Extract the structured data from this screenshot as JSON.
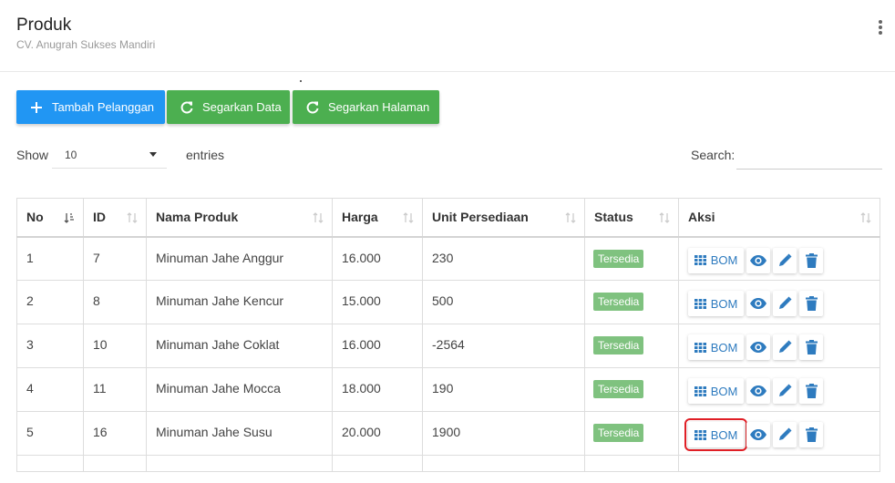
{
  "header": {
    "title": "Produk",
    "subtitle": "CV. Anugrah Sukses Mandiri"
  },
  "toolbar": {
    "add_label": "Tambah Pelanggan",
    "refresh_data_label": "Segarkan Data",
    "refresh_page_label": "Segarkan Halaman"
  },
  "length": {
    "show_label": "Show",
    "value": "10",
    "entries_label": "entries"
  },
  "search": {
    "label": "Search:",
    "value": ""
  },
  "table": {
    "columns": [
      "No",
      "ID",
      "Nama Produk",
      "Harga",
      "Unit Persediaan",
      "Status",
      "Aksi"
    ],
    "rows": [
      {
        "no": "1",
        "id": "7",
        "name": "Minuman Jahe Anggur",
        "price": "16.000",
        "stock": "230",
        "status": "Tersedia"
      },
      {
        "no": "2",
        "id": "8",
        "name": "Minuman Jahe Kencur",
        "price": "15.000",
        "stock": "500",
        "status": "Tersedia"
      },
      {
        "no": "3",
        "id": "10",
        "name": "Minuman Jahe Coklat",
        "price": "16.000",
        "stock": "-2564",
        "status": "Tersedia"
      },
      {
        "no": "4",
        "id": "11",
        "name": "Minuman Jahe Mocca",
        "price": "18.000",
        "stock": "190",
        "status": "Tersedia"
      },
      {
        "no": "5",
        "id": "16",
        "name": "Minuman Jahe Susu",
        "price": "20.000",
        "stock": "1900",
        "status": "Tersedia"
      }
    ],
    "bom_label": "BOM",
    "highlighted_row": 4
  },
  "icons": {
    "add": "plus-icon",
    "refresh": "refresh-icon",
    "bom": "grid-icon",
    "view": "eye-icon",
    "edit": "pencil-icon",
    "delete": "trash-icon",
    "menu": "kebab-menu-icon"
  },
  "colors": {
    "primary_blue": "#2196f3",
    "success_green": "#4caf50",
    "status_badge": "#7fc27f",
    "action_icon": "#2e7bbf",
    "highlight_border": "#e01f26"
  }
}
